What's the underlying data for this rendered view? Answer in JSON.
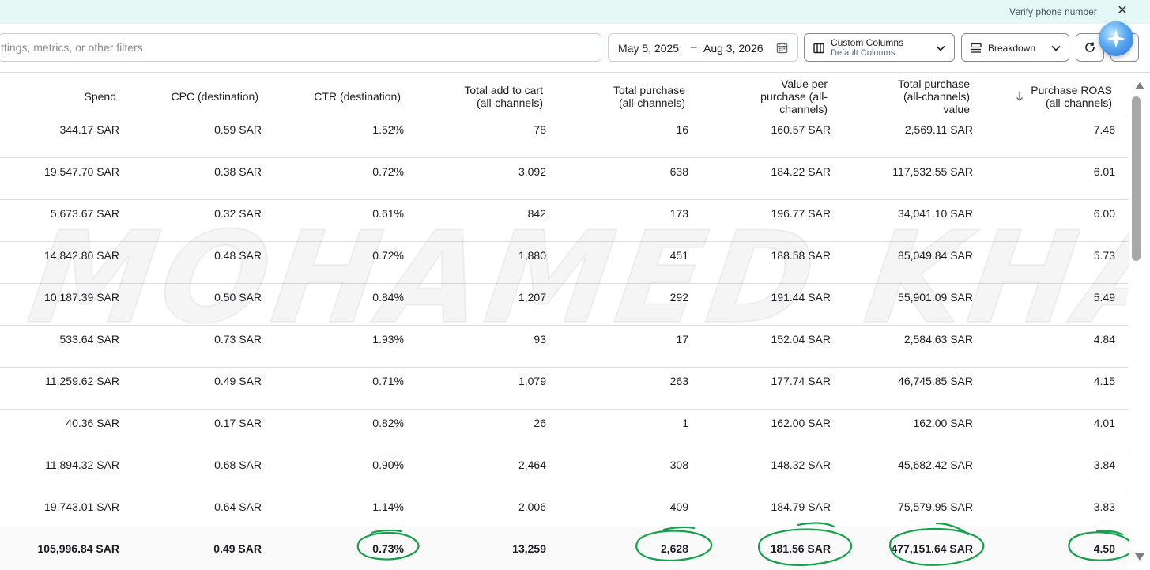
{
  "topbar": {
    "verify_label": "Verify phone number",
    "close_glyph": "✕"
  },
  "toolbar": {
    "search_placeholder": "ttings, metrics, or other filters",
    "date_start": "May 5, 2025",
    "date_sep": "–",
    "date_end": "Aug 3, 2026",
    "columns_title": "Custom Columns",
    "columns_sub": "Default Columns",
    "breakdown_label": "Breakdown"
  },
  "icons": {
    "calendar": "calendar-icon",
    "columns": "columns-icon",
    "breakdown": "breakdown-icon",
    "refresh": "refresh-icon",
    "ai": "ai-assistant-icon",
    "sort": "sort-descending-icon"
  },
  "colors": {
    "annotation": "#13a24a",
    "topbar": "#e5f8f6"
  },
  "watermark": "MOHAMED KHALED",
  "table": {
    "headers": [
      [
        "Spend"
      ],
      [
        "CPC (destination)"
      ],
      [
        "CTR (destination)"
      ],
      [
        "Total add to cart",
        "(all-channels)"
      ],
      [
        "Total purchase",
        "(all-channels)"
      ],
      [
        "Value per",
        "purchase (all-",
        "channels)"
      ],
      [
        "Total purchase",
        "(all-channels)",
        "value"
      ],
      [
        "Purchase ROAS",
        "(all-channels)"
      ]
    ],
    "rows": [
      [
        "344.17 SAR",
        "0.59 SAR",
        "1.52%",
        "78",
        "16",
        "160.57 SAR",
        "2,569.11 SAR",
        "7.46"
      ],
      [
        "19,547.70 SAR",
        "0.38 SAR",
        "0.72%",
        "3,092",
        "638",
        "184.22 SAR",
        "117,532.55 SAR",
        "6.01"
      ],
      [
        "5,673.67 SAR",
        "0.32 SAR",
        "0.61%",
        "842",
        "173",
        "196.77 SAR",
        "34,041.10 SAR",
        "6.00"
      ],
      [
        "14,842.80 SAR",
        "0.48 SAR",
        "0.72%",
        "1,880",
        "451",
        "188.58 SAR",
        "85,049.84 SAR",
        "5.73"
      ],
      [
        "10,187.39 SAR",
        "0.50 SAR",
        "0.84%",
        "1,207",
        "292",
        "191.44 SAR",
        "55,901.09 SAR",
        "5.49"
      ],
      [
        "533.64 SAR",
        "0.73 SAR",
        "1.93%",
        "93",
        "17",
        "152.04 SAR",
        "2,584.63 SAR",
        "4.84"
      ],
      [
        "11,259.62 SAR",
        "0.49 SAR",
        "0.71%",
        "1,079",
        "263",
        "177.74 SAR",
        "46,745.85 SAR",
        "4.15"
      ],
      [
        "40.36 SAR",
        "0.17 SAR",
        "0.82%",
        "26",
        "1",
        "162.00 SAR",
        "162.00 SAR",
        "4.01"
      ],
      [
        "11,894.32 SAR",
        "0.68 SAR",
        "0.90%",
        "2,464",
        "308",
        "148.32 SAR",
        "45,682.42 SAR",
        "3.84"
      ],
      [
        "19,743.01 SAR",
        "0.64 SAR",
        "1.14%",
        "2,006",
        "409",
        "184.79 SAR",
        "75,579.95 SAR",
        "3.83"
      ]
    ],
    "summary": [
      "105,996.84 SAR",
      "0.49 SAR",
      "0.73%",
      "13,259",
      "2,628",
      "181.56 SAR",
      "477,151.64 SAR",
      "4.50"
    ]
  }
}
